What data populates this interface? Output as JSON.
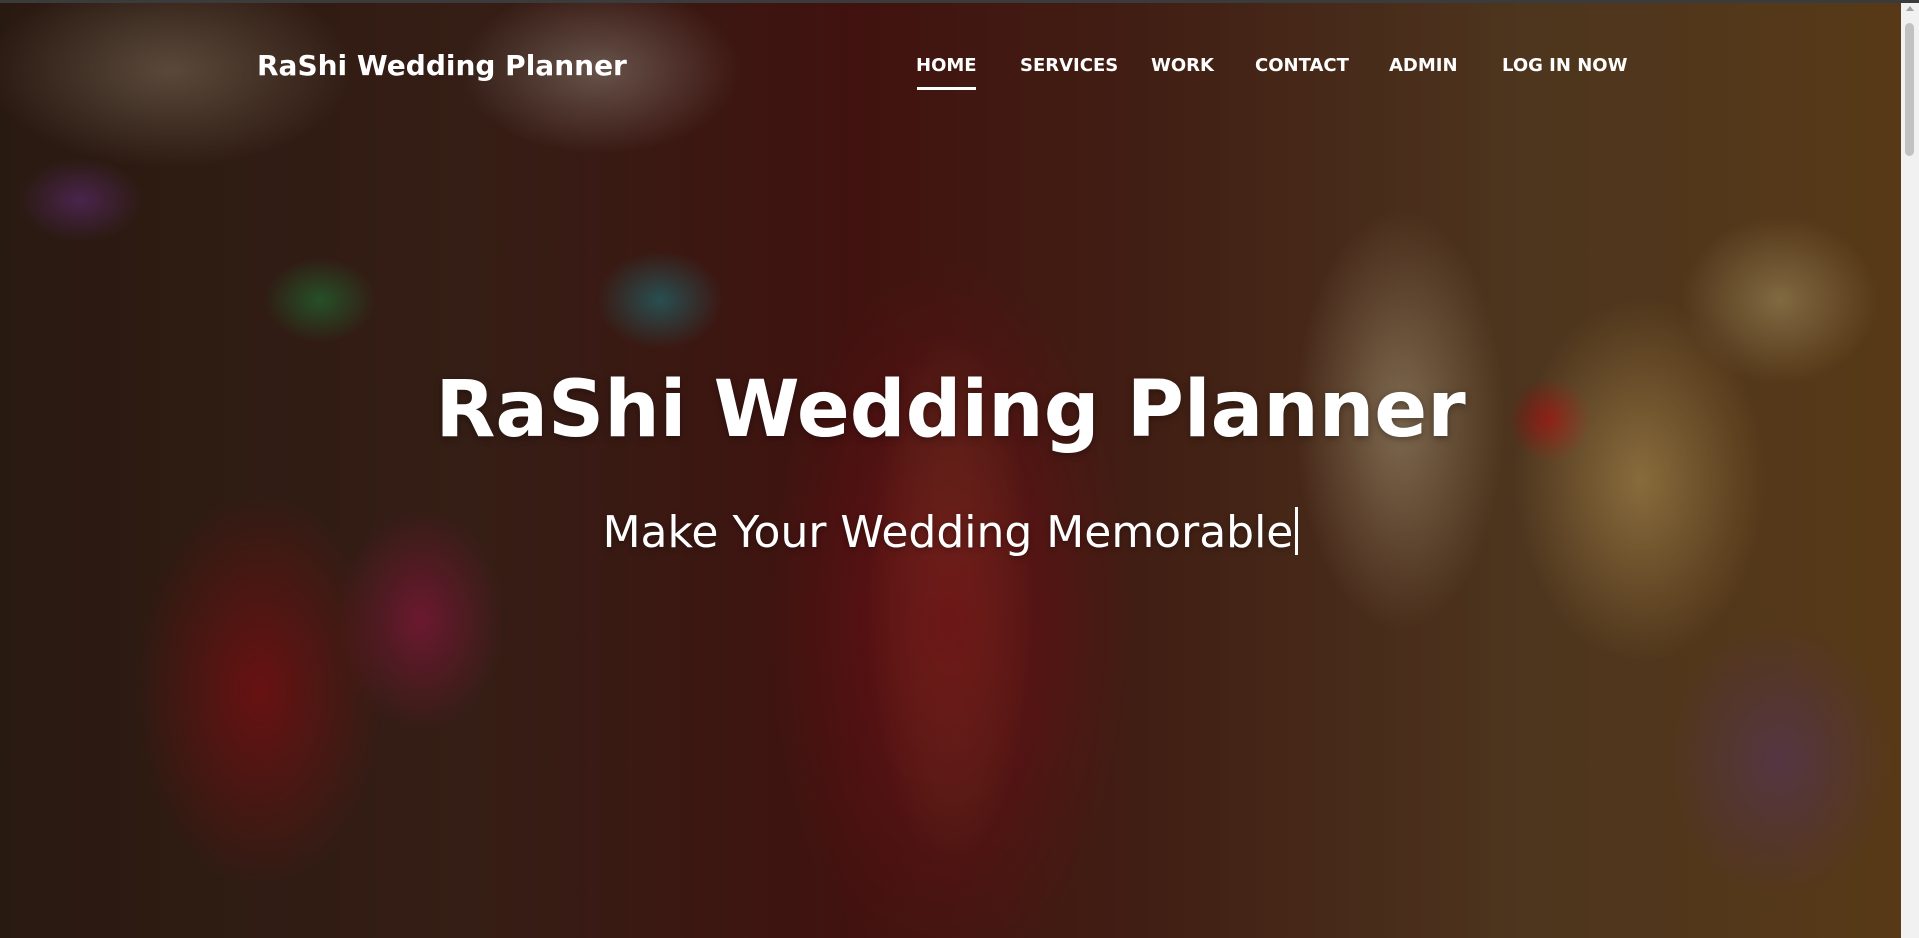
{
  "brand": {
    "name": "RaShi Wedding Planner"
  },
  "nav": {
    "items": [
      {
        "label": "HOME",
        "active": true
      },
      {
        "label": "SERVICES",
        "active": false
      },
      {
        "label": "WORK",
        "active": false
      },
      {
        "label": "CONTACT",
        "active": false
      },
      {
        "label": "ADMIN",
        "active": false
      },
      {
        "label": "LOG IN NOW",
        "active": false
      }
    ]
  },
  "hero": {
    "title": "RaShi Wedding Planner",
    "subtitle": "Make Your Wedding Memorable"
  },
  "colors": {
    "text": "#ffffff",
    "overlay": "rgba(0,0,0,0.28)",
    "scrollbar_track": "#f1f1f1",
    "scrollbar_thumb": "#c1c1c1"
  }
}
